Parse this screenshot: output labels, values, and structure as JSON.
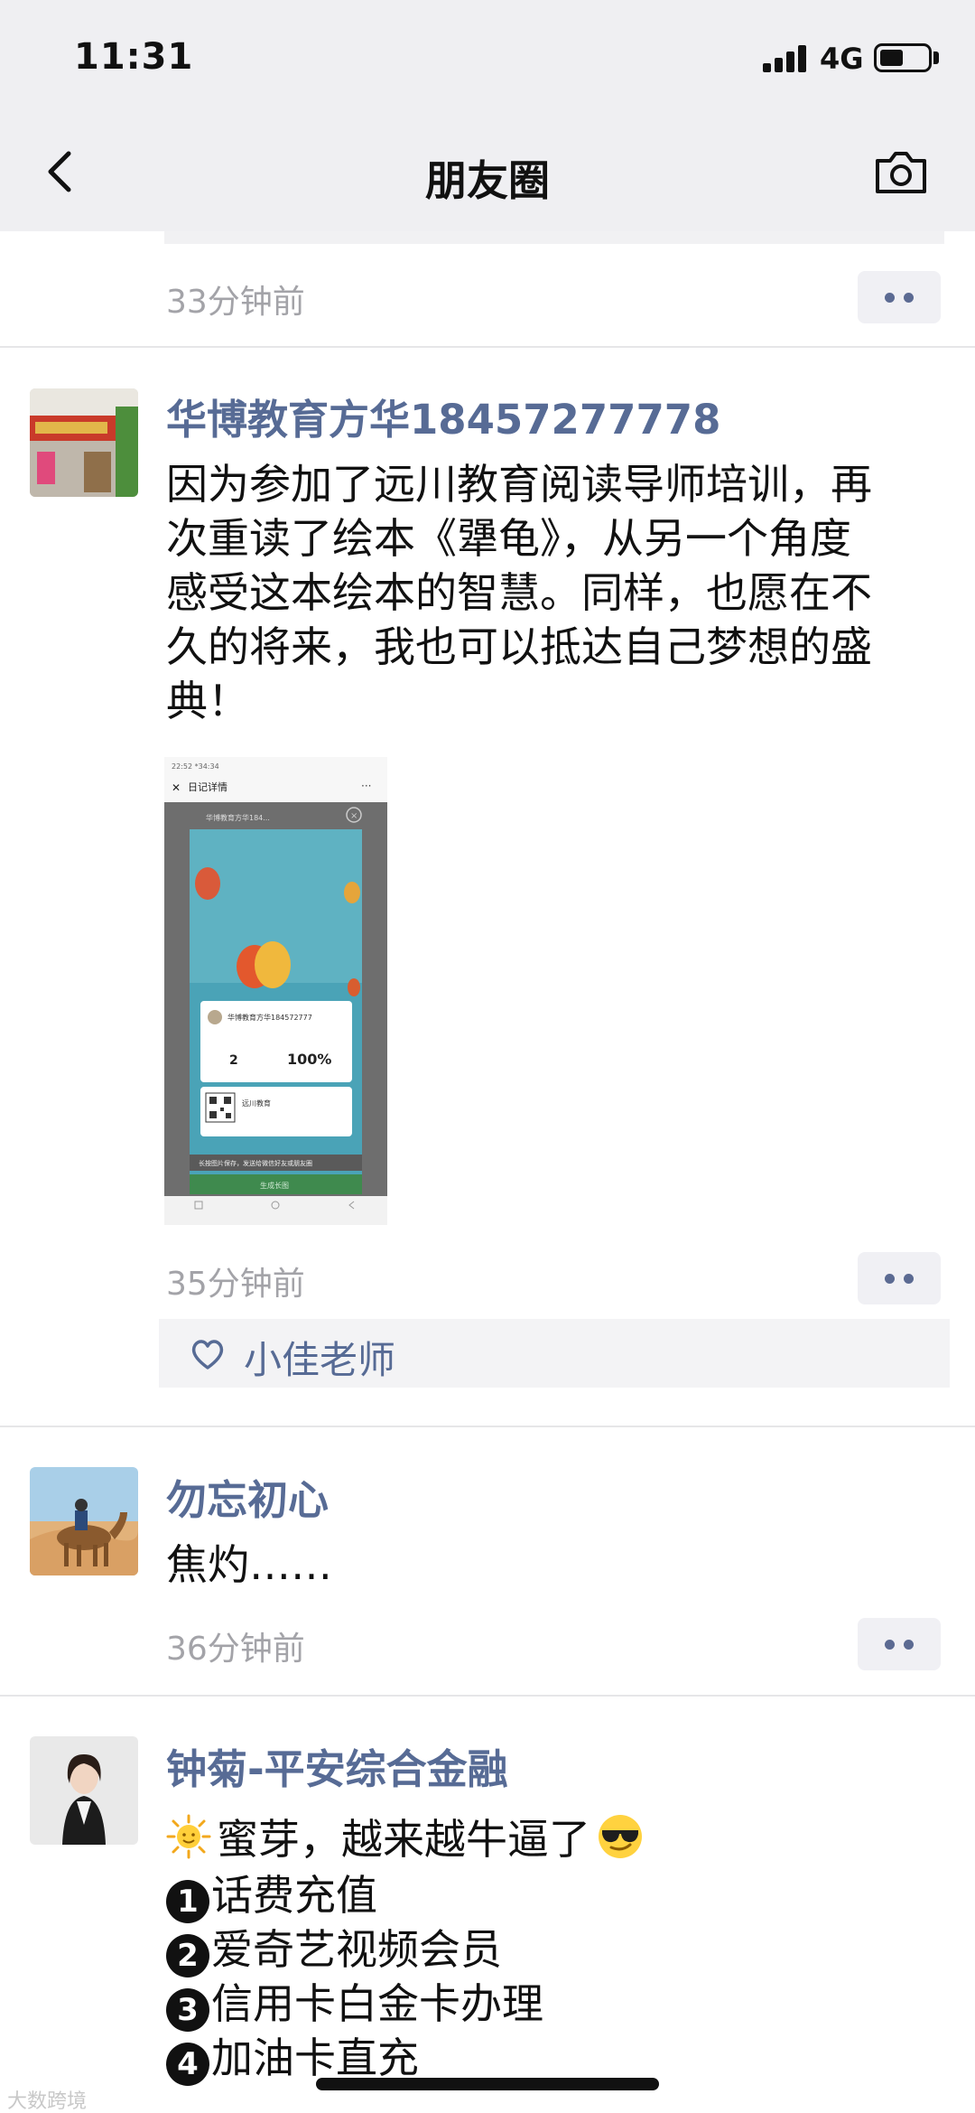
{
  "status_bar": {
    "time": "11:31",
    "network": "4G",
    "icons": [
      "signal-icon",
      "battery-icon"
    ]
  },
  "nav": {
    "title": "朋友圈",
    "back_icon": "chevron-left-icon",
    "camera_icon": "camera-icon"
  },
  "posts": [
    {
      "time": "33分钟前"
    },
    {
      "name": "华博教育方华18457277778",
      "lines": [
        "因为参加了远川教育阅读导师培训，再",
        "次重读了绘本《犟龟》，从另一个角度",
        "感受这本绘本的智慧。同样，也愿在不",
        "久的将来，我也可以抵达自己梦想的盛",
        "典！"
      ],
      "time": "35分钟前",
      "likes": [
        "小佳老师"
      ],
      "image": {
        "statusbar": "22:52 *34:34",
        "header": "日记详情",
        "author": "华博教育方华184...",
        "card_name": "华博教育方华184572777",
        "count": "2",
        "percent": "100%",
        "brand": "远川教育",
        "tip": "长按图片保存，发送给微信好友或朋友圈",
        "button": "生成长图"
      }
    },
    {
      "name": "勿忘初心",
      "text": "焦灼……",
      "time": "36分钟前"
    },
    {
      "name": "钟菊-平安综合金融",
      "intro": "蜜芽，越来越牛逼了",
      "items": [
        {
          "num": "1",
          "text": "话费充值"
        },
        {
          "num": "2",
          "text": "爱奇艺视频会员"
        },
        {
          "num": "3",
          "text": "信用卡白金卡办理"
        },
        {
          "num": "4",
          "text": "加油卡直充"
        }
      ]
    }
  ],
  "watermark": "大数跨境",
  "colors": {
    "link": "#576b95",
    "time": "#a3a3a8",
    "bar": "#efeff2"
  }
}
